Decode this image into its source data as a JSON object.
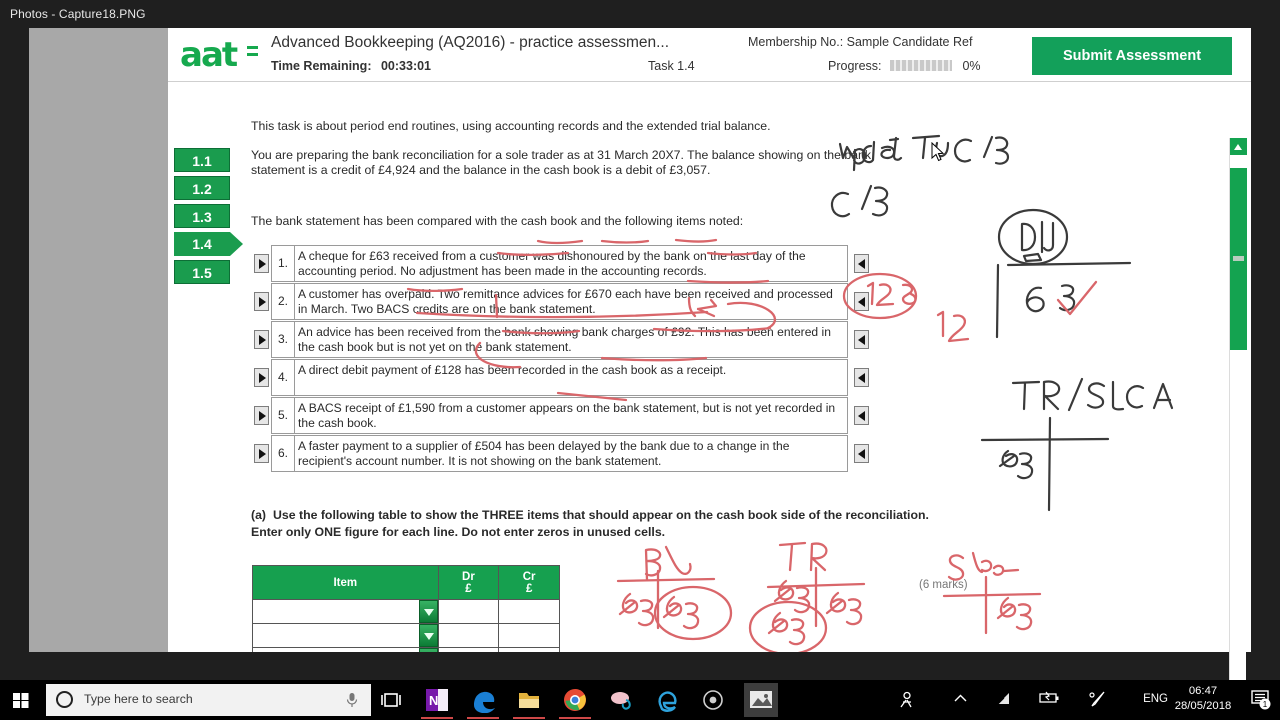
{
  "window": {
    "title": "Photos - Capture18.PNG"
  },
  "header": {
    "logo_text": "aat",
    "title": "Advanced Bookkeeping (AQ2016) - practice assessmen...",
    "time_label": "Time Remaining:",
    "time_value": "00:33:01",
    "task_label": "Task 1.4",
    "membership": "Membership No.: Sample Candidate Ref",
    "progress_label": "Progress:",
    "progress_value": "0%",
    "submit_label": "Submit Assessment",
    "accent_green": "#13a05a"
  },
  "task_nav": {
    "items": [
      {
        "label": "1.1",
        "active": false
      },
      {
        "label": "1.2",
        "active": false
      },
      {
        "label": "1.3",
        "active": false
      },
      {
        "label": "1.4",
        "active": true
      },
      {
        "label": "1.5",
        "active": false
      }
    ]
  },
  "paper": {
    "intro1": "This task is about period end routines, using accounting records and the extended trial balance.",
    "intro2": "You are preparing the bank reconciliation for a sole trader as at 31 March 20X7. The balance showing on the bank statement is a credit of £4,924 and the balance in the cash book is a debit of £3,057.",
    "intro3": "The bank statement has been compared with the cash book and the following items noted:",
    "items": [
      {
        "num": "1.",
        "text": "A cheque for £63 received from a customer was dishonoured by the bank on the last day of the accounting period. No adjustment has been made in the accounting records."
      },
      {
        "num": "2.",
        "text": "A customer has overpaid. Two remittance advices for £670 each have been received and processed in March. Two BACS credits are on the bank statement."
      },
      {
        "num": "3.",
        "text": "An advice has been received from the bank showing bank charges of £92. This has been entered in the cash book but is not yet on the bank statement."
      },
      {
        "num": "4.",
        "text": "A direct debit payment of £128 has been recorded in the cash book as a receipt."
      },
      {
        "num": "5.",
        "text": "A BACS receipt of £1,590 from a customer appears on the bank statement, but is not yet recorded in the cash book."
      },
      {
        "num": "6.",
        "text": "A faster payment to a supplier of £504 has been delayed by the bank due to a change in the recipient's account number. It is not showing on the bank statement."
      }
    ],
    "part_a_letter": "(a)",
    "part_a_text": "Use the following table to show the THREE items that should appear on the cash book side of the reconciliation. Enter only ONE figure for each line. Do not enter zeros in unused cells.",
    "marks": "(6 marks)",
    "answer_table": {
      "headers": [
        "Item",
        "Dr\n£",
        "Cr\n£"
      ],
      "header_item": "Item",
      "header_dr_line1": "Dr",
      "header_dr_line2": "£",
      "header_cr_line1": "Cr",
      "header_cr_line2": "£",
      "rows": [
        {
          "item": "",
          "dr": "",
          "cr": ""
        },
        {
          "item": "",
          "dr": "",
          "cr": ""
        },
        {
          "item": "",
          "dr": "",
          "cr": ""
        }
      ]
    }
  },
  "annotations": {
    "ink_black": [
      {
        "text": "update the C/B",
        "note": "handwritten top right"
      },
      {
        "text": "C/B",
        "note": "handwritten below"
      },
      {
        "text": "D|J",
        "note": "circled, handwritten"
      },
      {
        "text": "63",
        "note": "black figure in red T-account"
      },
      {
        "text": "TR/SLCA",
        "note": "T-account heading"
      },
      {
        "text": "63",
        "note": "debit side of TR/SLCA T-account"
      }
    ],
    "ink_red": [
      {
        "text": "128",
        "note": "circled on debit side of T-account"
      },
      {
        "text": "12",
        "note": "below 63"
      },
      {
        "text": "BL",
        "note": "T-account heading"
      },
      {
        "text": "63",
        "note": "BL debit"
      },
      {
        "text": "63",
        "note": "BL credit, circled"
      },
      {
        "text": "TR",
        "note": "T-account heading"
      },
      {
        "text": "63",
        "note": "TR debit"
      },
      {
        "text": "63",
        "note": "TR debit circled"
      },
      {
        "text": "63",
        "note": "TR credit"
      },
      {
        "text": "Sales",
        "note": "T-account heading"
      },
      {
        "text": "63",
        "note": "Sales credit"
      }
    ]
  },
  "taskbar": {
    "search_placeholder": "Type here to search",
    "apps": [
      {
        "name": "task-view"
      },
      {
        "name": "onenote"
      },
      {
        "name": "edge"
      },
      {
        "name": "file-explorer"
      },
      {
        "name": "chrome"
      },
      {
        "name": "paint-3d"
      },
      {
        "name": "internet-explorer"
      },
      {
        "name": "recorder"
      },
      {
        "name": "photos"
      }
    ],
    "language": "ENG",
    "time": "06:47",
    "date": "28/05/2018",
    "notification_count": "1"
  }
}
